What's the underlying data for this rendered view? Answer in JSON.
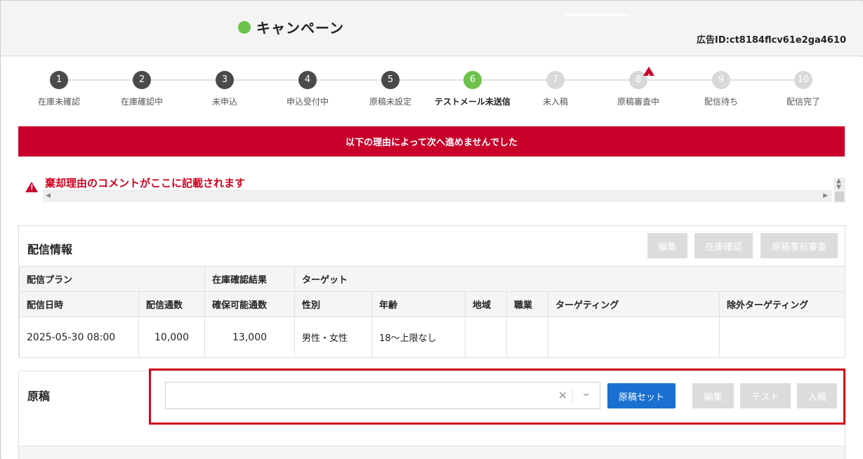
{
  "header": {
    "title": "キャンペーン",
    "ad_id": "広告ID:ct8184flcv61e2ga4610"
  },
  "steps": [
    {
      "num": "1",
      "label": "在庫未確認",
      "state": "done"
    },
    {
      "num": "2",
      "label": "在庫確認中",
      "state": "done"
    },
    {
      "num": "3",
      "label": "未申込",
      "state": "done"
    },
    {
      "num": "4",
      "label": "申込受付中",
      "state": "done"
    },
    {
      "num": "5",
      "label": "原稿未設定",
      "state": "done"
    },
    {
      "num": "6",
      "label": "テストメール未送信",
      "state": "current"
    },
    {
      "num": "7",
      "label": "未入稿",
      "state": "todo"
    },
    {
      "num": "8",
      "label": "原稿審査中",
      "state": "todo",
      "warning": true
    },
    {
      "num": "9",
      "label": "配信待ち",
      "state": "todo"
    },
    {
      "num": "10",
      "label": "配信完了",
      "state": "todo"
    }
  ],
  "error_banner": "以下の理由によって次へ進めませんでした",
  "reason": "棄却理由のコメントがここに記載されます",
  "delivery": {
    "title": "配信情報",
    "buttons": {
      "edit": "編集",
      "stock_check": "在庫確認",
      "pre_review": "原稿事前審査"
    },
    "group_headers": {
      "plan": "配信プラン",
      "stock_result": "在庫確認結果",
      "target": "ターゲット"
    },
    "columns": {
      "datetime": "配信日時",
      "count": "配信通数",
      "secured": "確保可能通数",
      "gender": "性別",
      "age": "年齢",
      "region": "地域",
      "job": "職業",
      "targeting": "ターゲティング",
      "exclude": "除外ターゲティング"
    },
    "row": {
      "datetime": "2025-05-30 08:00",
      "count": "10,000",
      "secured": "13,000",
      "gender": "男性・女性",
      "age": "18～上限なし",
      "region": "",
      "job": "",
      "targeting": "",
      "exclude": ""
    }
  },
  "manuscript": {
    "title": "原稿",
    "select_value": "",
    "set_button": "原稿セット",
    "edit_button": "編集",
    "test_button": "テスト",
    "submit_button": "入稿"
  },
  "colors": {
    "accent_green": "#6cc24a",
    "error_red": "#c8002a",
    "primary_blue": "#1a6fd1"
  }
}
